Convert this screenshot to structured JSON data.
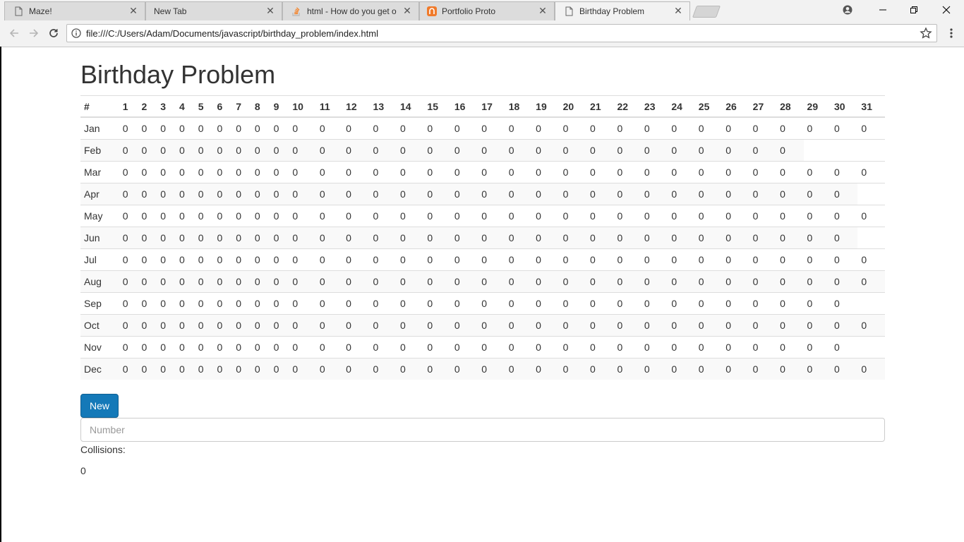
{
  "browser": {
    "tabs": [
      {
        "title": "Maze!",
        "icon": "page-icon"
      },
      {
        "title": "New Tab",
        "icon": "none"
      },
      {
        "title": "html - How do you get o",
        "icon": "stackoverflow-icon"
      },
      {
        "title": "Portfolio Proto",
        "icon": "portfolio-icon"
      },
      {
        "title": "Birthday Problem",
        "icon": "page-icon",
        "active": true
      }
    ],
    "url": "file:///C:/Users/Adam/Documents/javascript/birthday_problem/index.html"
  },
  "page": {
    "title": "Birthday Problem",
    "table": {
      "corner_header": "#",
      "days": [
        "1",
        "2",
        "3",
        "4",
        "5",
        "6",
        "7",
        "8",
        "9",
        "10",
        "11",
        "12",
        "13",
        "14",
        "15",
        "16",
        "17",
        "18",
        "19",
        "20",
        "21",
        "22",
        "23",
        "24",
        "25",
        "26",
        "27",
        "28",
        "29",
        "30",
        "31"
      ],
      "months": [
        {
          "name": "Jan",
          "days": 31
        },
        {
          "name": "Feb",
          "days": 28
        },
        {
          "name": "Mar",
          "days": 31
        },
        {
          "name": "Apr",
          "days": 30
        },
        {
          "name": "May",
          "days": 31
        },
        {
          "name": "Jun",
          "days": 30
        },
        {
          "name": "Jul",
          "days": 31
        },
        {
          "name": "Aug",
          "days": 31
        },
        {
          "name": "Sep",
          "days": 30
        },
        {
          "name": "Oct",
          "days": 31
        },
        {
          "name": "Nov",
          "days": 30
        },
        {
          "name": "Dec",
          "days": 31
        }
      ],
      "cell_value": "0"
    },
    "new_button_label": "New",
    "number_placeholder": "Number",
    "collisions_label": "Collisions:",
    "collisions_value": "0"
  },
  "colors": {
    "button": "#1479b8",
    "stripe": "#f9f9f9",
    "border": "#dddddd"
  }
}
